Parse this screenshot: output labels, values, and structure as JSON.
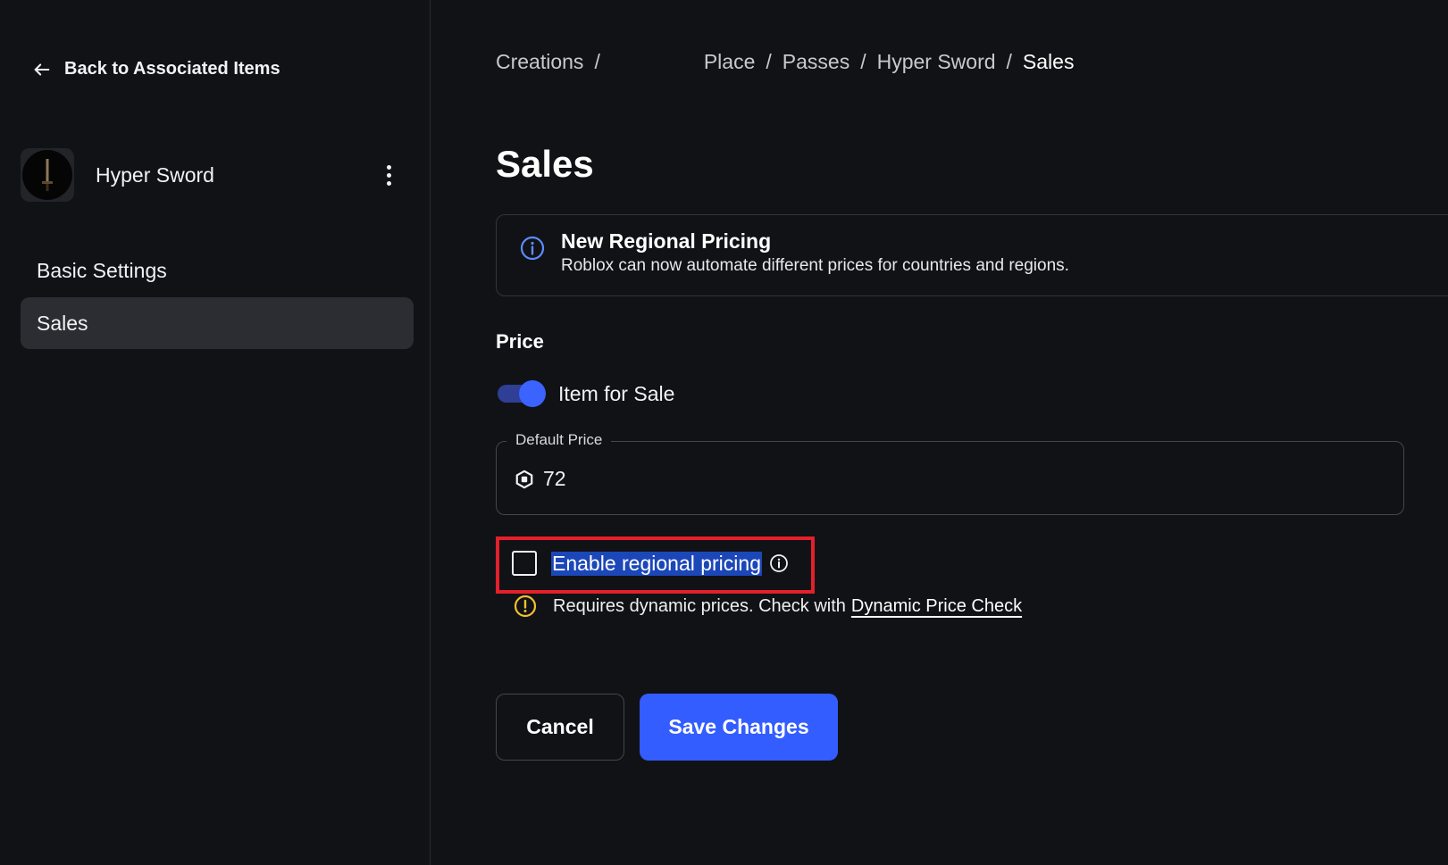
{
  "sidebar": {
    "back_label": "Back to Associated Items",
    "item_name": "Hyper Sword",
    "nav": [
      {
        "label": "Basic Settings"
      },
      {
        "label": "Sales"
      }
    ]
  },
  "breadcrumb": [
    "Creations",
    "Place",
    "Passes",
    "Hyper Sword",
    "Sales"
  ],
  "page": {
    "title": "Sales",
    "banner": {
      "title": "New Regional Pricing",
      "text": "Roblox can now automate different prices for countries and regions."
    },
    "price": {
      "section_label": "Price",
      "toggle_label": "Item for Sale",
      "toggle_on": true,
      "default_price_label": "Default Price",
      "default_price_value": "72",
      "regional_label": "Enable regional pricing",
      "regional_checked": false,
      "warning_text": "Requires dynamic prices. Check with",
      "warning_link": "Dynamic Price Check"
    },
    "buttons": {
      "cancel": "Cancel",
      "save": "Save Changes"
    }
  },
  "colors": {
    "background": "#111216",
    "accent": "#335dff",
    "highlight_border": "#e3202b",
    "warning": "#f2c12e",
    "info": "#5b8cff"
  },
  "icons": [
    "arrow-left-icon",
    "kebab-menu-icon",
    "info-icon",
    "robux-icon",
    "warning-icon"
  ]
}
